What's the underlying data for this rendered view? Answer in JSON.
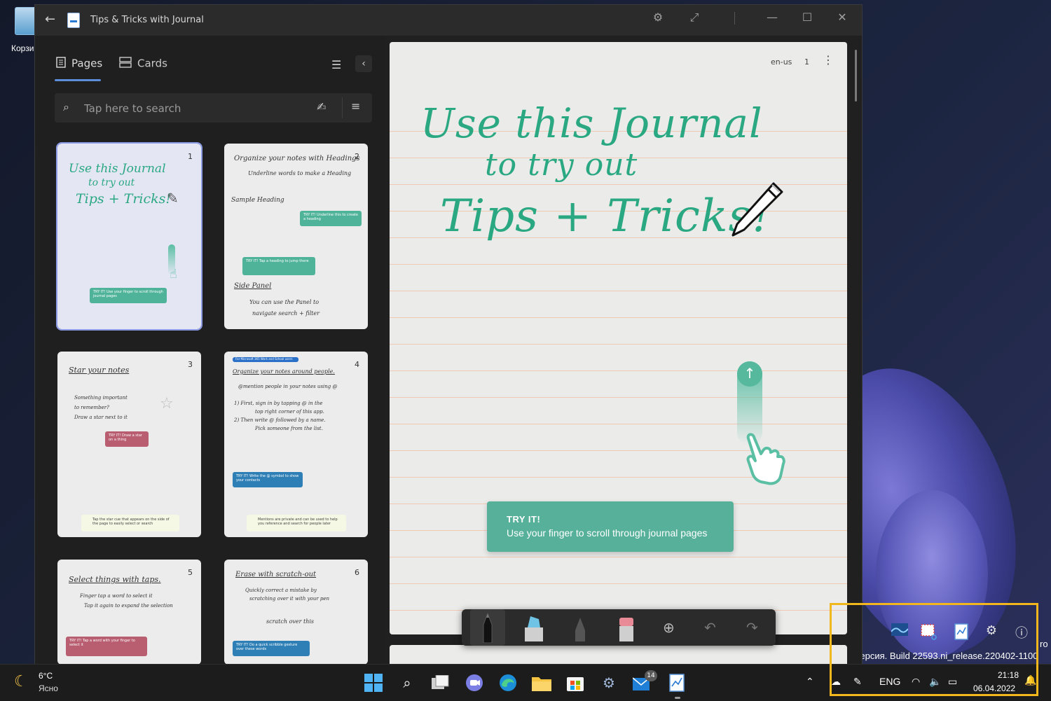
{
  "desktop": {
    "recycle_bin_label": "Корзи",
    "build_text": "я версия. Build 22593.ni_release.220402-1100",
    "pro_text": "ro"
  },
  "window": {
    "title": "Tips & Tricks with Journal"
  },
  "sidebar": {
    "tab_pages": "Pages",
    "tab_cards": "Cards",
    "search_placeholder": "Tap here to search"
  },
  "thumbnails": [
    {
      "num": "1",
      "lines": [
        "Use this Journal",
        "to try out",
        "Tips + Tricks!"
      ],
      "chip": "TRY IT! Use your finger to scroll through journal pages"
    },
    {
      "num": "2",
      "lines": [
        "Organize your notes with Headings",
        "Underline words to make a Heading",
        "Sample Heading",
        "Side Panel",
        "You can use the Panel to",
        "navigate search + filter"
      ],
      "chip1": "TRY IT! Underline this to create a heading",
      "chip2": "TRY IT! Tap a heading to jump there"
    },
    {
      "num": "3",
      "lines": [
        "Star your notes",
        "Something important",
        "to remember?",
        "Draw a star next to it"
      ],
      "chip": "TRY IT! Draw a star on a thing",
      "tip": "Tap the star cue that appears on the side of the page to easily select or search"
    },
    {
      "num": "4",
      "lines": [
        "Organize your notes around people.",
        "@mention people in your notes using @",
        "1) First, sign in by tapping @ in the",
        "top right corner of this app.",
        "2) Then write @ followed by a name.",
        "Pick someone from the list."
      ],
      "top_chip": "For Microsoft 365 Work and School users",
      "chip": "TRY IT! Write the @ symbol to show your contacts",
      "tip": "Mentions are private and can be used to help you reference and search for people later"
    },
    {
      "num": "5",
      "lines": [
        "Select things with taps.",
        "Finger tap a word to select it",
        "Tap it again to expand the selection"
      ],
      "chip": "TRY IT! Tap a word with your finger to select it"
    },
    {
      "num": "6",
      "lines": [
        "Erase with scratch-out",
        "Quickly correct a mistake by",
        "scratching over it with your pen",
        "scratch over this"
      ],
      "chip": "TRY IT! Do a quick scribble gesture over these words"
    }
  ],
  "page": {
    "lang": "en-us",
    "page_num": "1",
    "handwriting": [
      "Use this Journal",
      "to try out",
      "Tips + Tricks!"
    ],
    "try_title": "TRY IT!",
    "try_text": "Use your finger to scroll through journal pages"
  },
  "taskbar": {
    "temperature": "6°C",
    "weather": "Ясно",
    "badge_count": "14",
    "lang": "ENG",
    "time": "21:18",
    "date": "06.04.2022"
  },
  "colors": {
    "accent_green": "#2aa882",
    "highlight_box": "#f3b71e",
    "try_it_bg": "#56b09a"
  }
}
